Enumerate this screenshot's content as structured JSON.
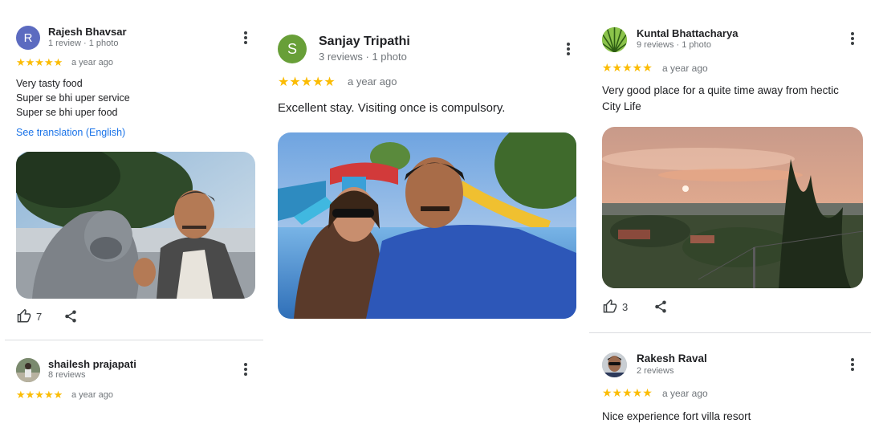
{
  "reviews": [
    {
      "name": "Rajesh Bhavsar",
      "meta": "1 review · 1 photo",
      "avatar_letter": "R",
      "avatar_color": "#5c6bc0",
      "stars": "★★★★★",
      "ago": "a year ago",
      "text_lines": [
        "Very tasty food",
        "Super se bhi uper service",
        "Super se bhi uper food"
      ],
      "translation_link": "See translation (English)",
      "likes": "7"
    },
    {
      "name": "Sanjay Tripathi",
      "meta": "3 reviews · 1 photo",
      "avatar_letter": "S",
      "avatar_color": "#689f38",
      "stars": "★★★★★",
      "ago": "a year ago",
      "text": "Excellent stay. Visiting once is compulsory."
    },
    {
      "name": "Kuntal Bhattacharya",
      "meta": "9 reviews · 1 photo",
      "stars": "★★★★★",
      "ago": "a year ago",
      "text_lines": [
        "Very good place for a quite time away from hectic",
        "City Life"
      ],
      "likes": "3"
    },
    {
      "name": "shailesh prajapati",
      "meta": "8 reviews",
      "stars": "★★★★★",
      "ago": "a year ago"
    },
    {
      "name": "Rakesh Raval",
      "meta": "2 reviews",
      "stars": "★★★★★",
      "ago": "a year ago",
      "text": "Nice experience fort villa resort"
    }
  ],
  "icons": {
    "more": "more-vert-icon",
    "like": "thumb-up-icon",
    "share": "share-icon"
  },
  "colors": {
    "star": "#fbbc04",
    "link": "#1a73e8",
    "meta": "#70757a"
  }
}
